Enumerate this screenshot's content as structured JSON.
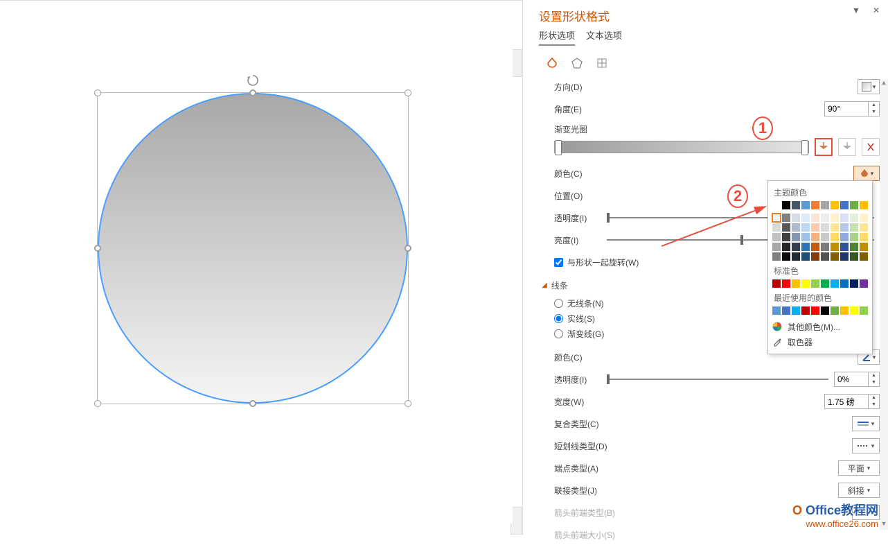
{
  "panel": {
    "title": "设置形状格式",
    "tabs": {
      "shape": "形状选项",
      "text": "文本选项"
    }
  },
  "controls": {
    "direction": "方向(D)",
    "angle": "角度(E)",
    "angle_value": "90°",
    "gradient_stops": "渐变光圈",
    "color": "颜色(C)",
    "position": "位置(O)",
    "transparency": "透明度(I)",
    "brightness": "亮度(I)",
    "rotate_with_shape": "与形状一起旋转(W)"
  },
  "line": {
    "section": "线条",
    "none": "无线条(N)",
    "solid": "实线(S)",
    "gradient": "渐变线(G)",
    "color": "颜色(C)",
    "transparency": "透明度(I)",
    "transparency_value": "0%",
    "width": "宽度(W)",
    "width_value": "1.75 磅",
    "compound": "复合类型(C)",
    "dash": "短划线类型(D)",
    "cap": "端点类型(A)",
    "cap_value": "平面",
    "join": "联接类型(J)",
    "join_value": "斜接",
    "arrow_begin": "箭头前端类型(B)",
    "arrow_begin_size": "箭头前端大小(S)"
  },
  "color_popup": {
    "theme": "主题颜色",
    "standard": "标准色",
    "recent": "最近使用的颜色",
    "more": "其他颜色(M)...",
    "eyedropper": "取色器",
    "theme_row1": [
      "#ffffff",
      "#000000",
      "#44546a",
      "#5b9bd5",
      "#ed7d31",
      "#a5a5a5",
      "#ffc000",
      "#4472c4",
      "#70ad47",
      "#ffc000"
    ],
    "theme_shades": [
      [
        "#f2f2f2",
        "#808080",
        "#d6dce5",
        "#deebf7",
        "#fbe5d6",
        "#ededed",
        "#fff2cc",
        "#d9e2f3",
        "#e2efda",
        "#fff2cc"
      ],
      [
        "#d9d9d9",
        "#595959",
        "#adb9ca",
        "#bdd7ee",
        "#f8cbad",
        "#dbdbdb",
        "#ffe699",
        "#b4c7e7",
        "#c5e0b4",
        "#ffe699"
      ],
      [
        "#bfbfbf",
        "#404040",
        "#8497b0",
        "#9dc3e6",
        "#f4b183",
        "#c9c9c9",
        "#ffd966",
        "#8faadc",
        "#a9d18e",
        "#ffd966"
      ],
      [
        "#a6a6a6",
        "#262626",
        "#333f50",
        "#2e75b6",
        "#c55a11",
        "#7b7b7b",
        "#bf9000",
        "#2f5597",
        "#548235",
        "#bf9000"
      ],
      [
        "#7f7f7f",
        "#0d0d0d",
        "#222a35",
        "#1f4e79",
        "#843c0c",
        "#525252",
        "#806000",
        "#203864",
        "#385723",
        "#806000"
      ]
    ],
    "standard_colors": [
      "#c00000",
      "#ff0000",
      "#ffc000",
      "#ffff00",
      "#92d050",
      "#00b050",
      "#00b0f0",
      "#0070c0",
      "#002060",
      "#7030a0"
    ],
    "recent_colors": [
      "#5b9bd5",
      "#4472c4",
      "#00b0f0",
      "#c00000",
      "#ff0000",
      "#000000",
      "#70ad47",
      "#ffc000",
      "#ffff00",
      "#92d050"
    ]
  },
  "annotations": {
    "one": "1",
    "two": "2"
  },
  "watermark": {
    "brand": "Office教程网",
    "url": "www.office26.com"
  }
}
